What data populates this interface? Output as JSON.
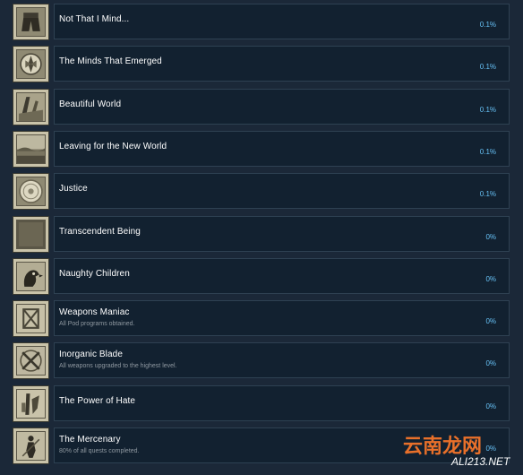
{
  "achievements": [
    {
      "title": "Not That I Mind...",
      "description": "",
      "percent": "0.1%",
      "icon": "shorts-icon"
    },
    {
      "title": "The Minds That Emerged",
      "description": "",
      "percent": "0.1%",
      "icon": "emblem-icon"
    },
    {
      "title": "Beautiful World",
      "description": "",
      "percent": "0.1%",
      "icon": "ruins-icon"
    },
    {
      "title": "Leaving for the New World",
      "description": "",
      "percent": "0.1%",
      "icon": "landscape-icon"
    },
    {
      "title": "Justice",
      "description": "",
      "percent": "0.1%",
      "icon": "circle-emblem-icon"
    },
    {
      "title": "Transcendent Being",
      "description": "",
      "percent": "0%",
      "icon": "blank-square-icon"
    },
    {
      "title": "Naughty Children",
      "description": "",
      "percent": "0%",
      "icon": "bird-icon"
    },
    {
      "title": "Weapons Maniac",
      "description": "All Pod programs obtained.",
      "percent": "0%",
      "icon": "pod-icon"
    },
    {
      "title": "Inorganic Blade",
      "description": "All weapons upgraded to the highest level.",
      "percent": "0%",
      "icon": "crossed-swords-icon"
    },
    {
      "title": "The Power of Hate",
      "description": "",
      "percent": "0%",
      "icon": "figure-icon"
    },
    {
      "title": "The Mercenary",
      "description": "80% of all quests completed.",
      "percent": "0%",
      "icon": "warrior-icon"
    }
  ],
  "watermark": {
    "text": "云南龙网",
    "subtext": "ALI213.NET"
  }
}
